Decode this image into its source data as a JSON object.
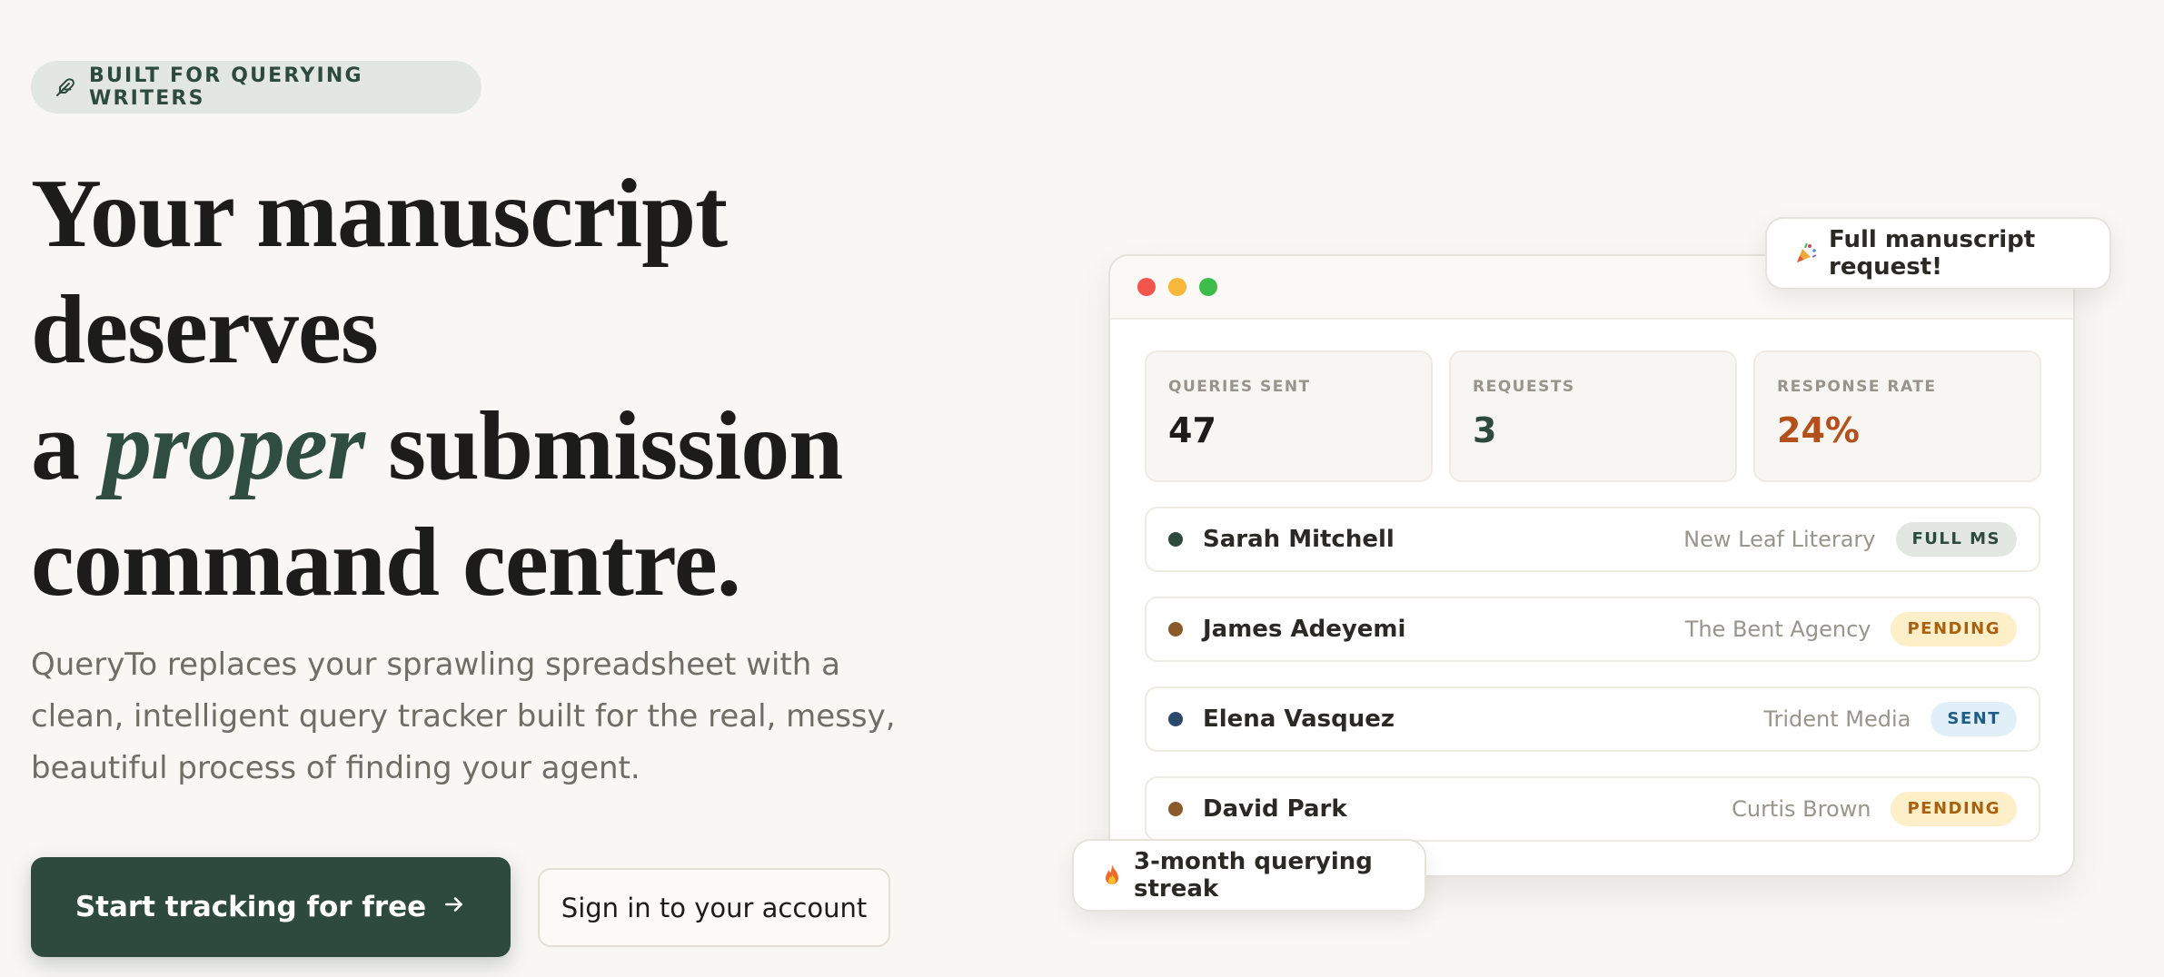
{
  "badge": {
    "icon": "feather-icon",
    "label": "BUILT FOR QUERYING WRITERS"
  },
  "headline": {
    "line1": "Your manuscript",
    "line2": "deserves",
    "line3_pre": "a ",
    "line3_em": "proper",
    "line3_post": " submission",
    "line4": "command centre."
  },
  "subtitle": "QueryTo replaces your sprawling spreadsheet with a clean, intelligent query tracker built for the real, messy, beautiful process of finding your agent.",
  "cta": {
    "primary_label": "Start tracking for free",
    "primary_icon": "arrow-right-icon",
    "secondary_label": "Sign in to your account"
  },
  "mockup": {
    "window_dots": [
      "#f2554c",
      "#f6b73a",
      "#3dbc4b"
    ],
    "stats": [
      {
        "label": "QUERIES SENT",
        "value": "47",
        "color": "#1c1c1a"
      },
      {
        "label": "REQUESTS",
        "value": "3",
        "color": "#2e4a3e"
      },
      {
        "label": "RESPONSE RATE",
        "value": "24%",
        "color": "#b3501b"
      }
    ],
    "agents": [
      {
        "name": "Sarah Mitchell",
        "agency": "New Leaf Literary",
        "status": "FULL MS",
        "dot": "#2e4a3e",
        "pill_bg": "#e2e8e1",
        "pill_fg": "#2e4a3e"
      },
      {
        "name": "James Adeyemi",
        "agency": "The Bent Agency",
        "status": "PENDING",
        "dot": "#8a5a2b",
        "pill_bg": "#fdf0c9",
        "pill_fg": "#a8620f"
      },
      {
        "name": "Elena Vasquez",
        "agency": "Trident Media",
        "status": "SENT",
        "dot": "#2b4a6a",
        "pill_bg": "#e1f0f8",
        "pill_fg": "#1e5d86"
      },
      {
        "name": "David Park",
        "agency": "Curtis Brown",
        "status": "PENDING",
        "dot": "#8a5a2b",
        "pill_bg": "#fdf0c9",
        "pill_fg": "#a8620f"
      }
    ]
  },
  "toasts": {
    "top": {
      "icon": "party-popper-icon",
      "text": "Full manuscript request!"
    },
    "bottom": {
      "icon": "fire-icon",
      "text": "3-month querying streak"
    }
  },
  "colors": {
    "background": "#f9f7f3",
    "brand": "#2e4a3e",
    "accent": "#b3501b"
  }
}
